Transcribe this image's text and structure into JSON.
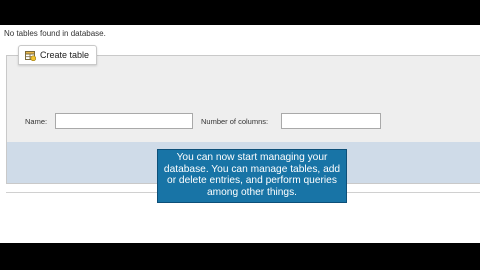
{
  "status": {
    "message": "No tables found in database."
  },
  "create_table": {
    "title": "Create table",
    "icon": "create-table-icon",
    "name_label": "Name:",
    "name_value": "",
    "columns_label": "Number of columns:",
    "columns_value": ""
  },
  "tooltip": {
    "text": "You can now start managing your database. You can manage tables, add or delete entries, and perform queries among other things."
  },
  "colors": {
    "panel_bg": "#eeeeee",
    "footer_band": "#cfdbe8",
    "tooltip_bg": "#1874a6"
  }
}
